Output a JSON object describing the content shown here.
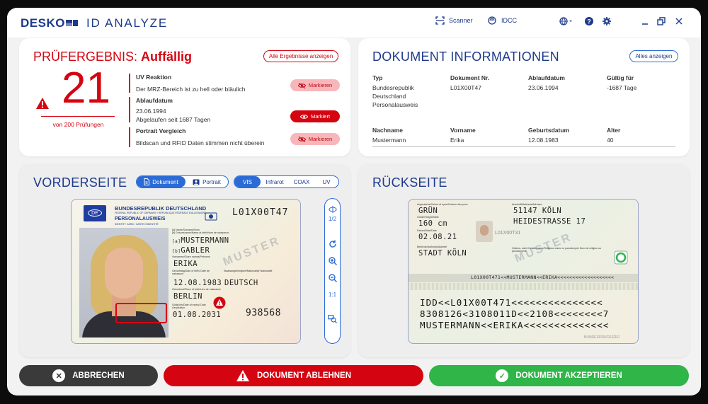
{
  "header": {
    "brand": "DESKO",
    "app_name": "ID ANALYZE",
    "scanner_label": "Scanner",
    "idcc_label": "IDCC",
    "icons": [
      "scanner-icon",
      "idcc-icon",
      "globe-icon",
      "help-icon",
      "settings-icon",
      "minimize-icon",
      "restore-icon",
      "close-icon"
    ]
  },
  "result": {
    "title_prefix": "PRÜFERGEBNIS:",
    "title_status": "Auffällig",
    "show_all_label": "Alle Ergebnisse anzeigen",
    "count": "21",
    "count_caption": "von 200 Prüfungen",
    "items": [
      {
        "title": "UV Reaktion",
        "detail": "Der MRZ-Bereich ist zu hell oder bläulich",
        "detail2": "",
        "action": "Markieren",
        "marked": false
      },
      {
        "title": "Ablaufdatum",
        "detail": "23.06.1994",
        "detail2": "Abgelaufen seit 1687 Tagen",
        "action": "Markiert",
        "marked": true
      },
      {
        "title": "Portrait Vergleich",
        "detail": "Bildscan und RFID Daten stimmen nicht überein",
        "detail2": "",
        "action": "Markieren",
        "marked": false
      }
    ]
  },
  "docinfo": {
    "title": "DOKUMENT INFORMATIONEN",
    "show_all_label": "Alles anzeigen",
    "row1": [
      {
        "label": "Typ",
        "value": "Bundesrepublik Deutschland Personalausweis"
      },
      {
        "label": "Dokument Nr.",
        "value": "L01X00T47"
      },
      {
        "label": "Ablaufdatum",
        "value": "23.06.1994"
      },
      {
        "label": "Gültig für",
        "value": "-1687 Tage"
      }
    ],
    "row2": [
      {
        "label": "Nachname",
        "value": "Mustermann"
      },
      {
        "label": "Vorname",
        "value": "Erika"
      },
      {
        "label": "Geburtsdatum",
        "value": "12.08.1983"
      },
      {
        "label": "Alter",
        "value": "40"
      }
    ]
  },
  "front": {
    "title": "VORDERSEITE",
    "view_tabs": [
      {
        "label": "Dokument",
        "active": true
      },
      {
        "label": "Portrait",
        "active": false
      }
    ],
    "light_tabs": [
      {
        "label": "VIS",
        "active": true
      },
      {
        "label": "Infrarot",
        "active": false
      },
      {
        "label": "COAX",
        "active": false
      },
      {
        "label": "UV",
        "active": false
      }
    ],
    "card": {
      "country_code": "DE",
      "header1": "BUNDESREPUBLIK DEUTSCHLAND",
      "header2": "FEDERAL REPUBLIC OF GERMANY / RÉPUBLIQUE FÉDÉRALE D'ALLEMAGNE",
      "header3": "PERSONALAUSWEIS",
      "header4": "IDENTITY CARD / CARTE D'IDENTITÉ",
      "doc_no": "L01X00T47",
      "lbl_name": "[a] Name/Surname/Nom",
      "lbl_birthname": "[b] Geburtsname/Name at birth/Nom de naissance",
      "surname_prefix": "[a]",
      "surname": "MUSTERMANN",
      "birthname_prefix": "[b]",
      "birthname": "GABLER",
      "lbl_given": "Vornamen/Given names/Prénoms",
      "given": "ERIKA",
      "lbl_dob": "Geburtstag/Date of birth/ Date de naissance",
      "lbl_nat": "Staatsangehörigkeit/Nationality/ Nationalité",
      "dob": "12.08.1983",
      "nationality": "DEUTSCH",
      "lbl_pob": "Geburtsort/Place of birth/Lieu de naissance",
      "pob": "BERLIN",
      "lbl_expiry": "Gültig bis/Date of expiry/ Date d'expiration",
      "expiry": "01.08.2031",
      "can": "938568",
      "watermark": "MUSTER"
    },
    "tools": {
      "page": "1/2",
      "zoom_reset": "1:1",
      "icons": [
        "page-flip-icon",
        "rotate-icon",
        "zoom-in-icon",
        "zoom-out-icon",
        "compare-icon"
      ]
    }
  },
  "back": {
    "title": "RÜCKSEITE",
    "card": {
      "lbl_eyes": "Augenfarbe/Colour of eyes/Couleur des yeux",
      "eyes": "GRÜN",
      "lbl_height": "Größe/Height/Taille",
      "height": "160 cm",
      "lbl_issued": "Datum/Date/Date",
      "issued": "02.08.21",
      "lbl_authority": "Behörde/Authority/Autorité",
      "authority": "STADT KÖLN",
      "lbl_address": "Anschrift/Address/Adresse",
      "address1": "51147 KÖLN",
      "address2": "HEIDESTRASSE 17",
      "lbl_religious": "Ordens- oder Künstlername/Religious name or pseudonym/ Nom de religion ou pseudonyme",
      "mrz_top": "L01X00T471<<MUSTERMANN<<ERIKA<<<<<<<<<<<<<<<<<<<",
      "mrz1": "IDD<<L01X00T471<<<<<<<<<<<<<<<",
      "mrz2": "8308126<3108011D<<2108<<<<<<<<7",
      "mrz3": "MUSTERMANN<<ERIKA<<<<<<<<<<<<<<",
      "printer": "BUNDESDRUCKEREI",
      "photo_code": "L01X00T31",
      "watermark": "MUSTER"
    }
  },
  "actions": {
    "cancel": "ABBRECHEN",
    "reject": "DOKUMENT ABLEHNEN",
    "accept": "DOKUMENT AKZEPTIEREN"
  },
  "colors": {
    "brand_blue": "#1d3a8c",
    "alert_red": "#d40511",
    "accept_green": "#2fb548",
    "cancel_dark": "#3a3a3a",
    "accent_blue": "#2b6bd6"
  }
}
